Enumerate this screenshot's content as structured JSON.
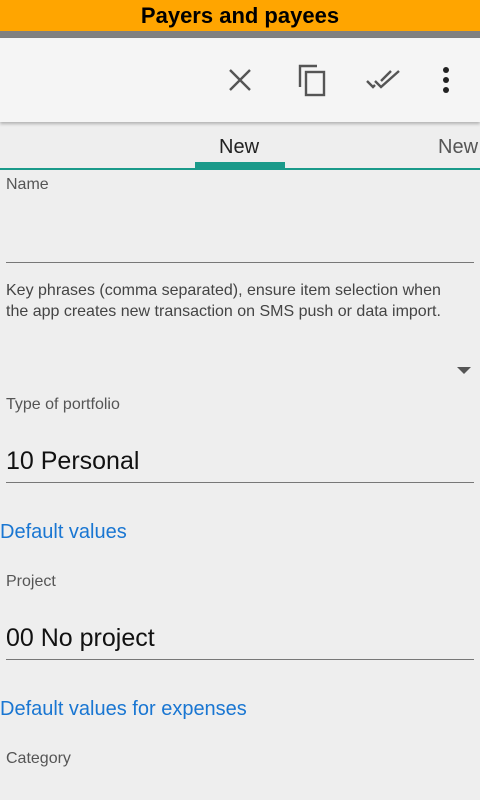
{
  "banner": {
    "title": "Payers and payees"
  },
  "toolbar": {
    "icons": [
      "close-icon",
      "copy-icon",
      "done-all-icon",
      "more-vert-icon"
    ]
  },
  "tabs": [
    {
      "label": "New"
    },
    {
      "label": "New"
    }
  ],
  "form": {
    "name_label": "Name",
    "name_value": "",
    "key_phrases_hint": "Key phrases (comma separated), ensure item selection when the app creates new transaction on SMS push or data import.",
    "portfolio_label": "Type of portfolio",
    "portfolio_value": "10 Personal",
    "section_default_values": "Default values",
    "project_label": "Project",
    "project_value": "00 No project",
    "section_default_expenses": "Default values for expenses",
    "category_label": "Category"
  },
  "colors": {
    "banner": "#ffa500",
    "accent": "#1a9a8a",
    "link": "#1976d2"
  }
}
